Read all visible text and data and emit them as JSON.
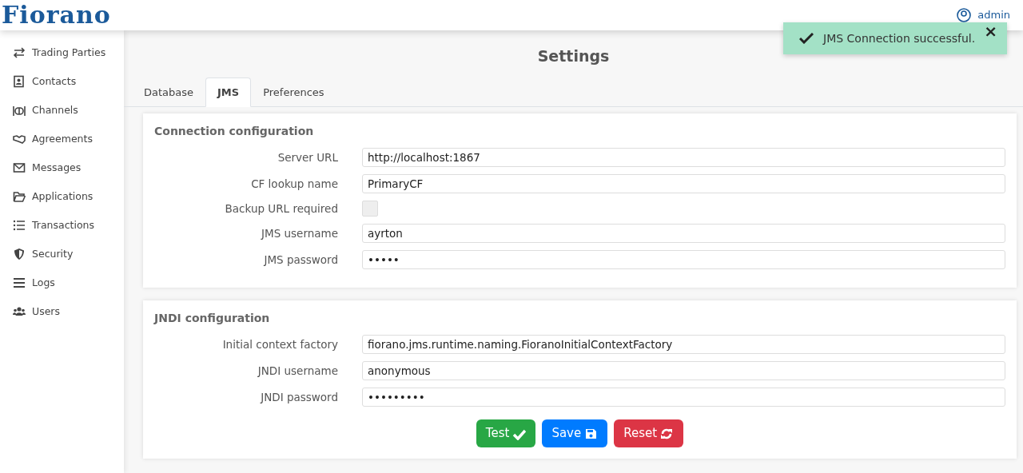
{
  "header": {
    "logo": "Fiorano",
    "user": "admin"
  },
  "sidebar": {
    "items": [
      {
        "label": "Trading Parties"
      },
      {
        "label": "Contacts"
      },
      {
        "label": "Channels"
      },
      {
        "label": "Agreements"
      },
      {
        "label": "Messages"
      },
      {
        "label": "Applications"
      },
      {
        "label": "Transactions"
      },
      {
        "label": "Security"
      },
      {
        "label": "Logs"
      },
      {
        "label": "Users"
      }
    ]
  },
  "page_title": "Settings",
  "tabs": [
    {
      "label": "Database",
      "selected": false
    },
    {
      "label": "JMS",
      "selected": true
    },
    {
      "label": "Preferences",
      "selected": false
    }
  ],
  "sections": [
    {
      "title": "Connection configuration",
      "fields": [
        {
          "kind": "text",
          "label": "Server URL",
          "value": "http://localhost:1867"
        },
        {
          "kind": "text",
          "label": "CF lookup name",
          "value": "PrimaryCF"
        },
        {
          "kind": "checkbox",
          "label": "Backup URL required",
          "checked": false
        },
        {
          "kind": "text",
          "label": "JMS username",
          "value": "ayrton"
        },
        {
          "kind": "text",
          "label": "JMS password",
          "value": "•••••"
        }
      ]
    },
    {
      "title": "JNDI configuration",
      "fields": [
        {
          "kind": "text",
          "label": "Initial context factory",
          "value": "fiorano.jms.runtime.naming.FioranoInitialContextFactory"
        },
        {
          "kind": "text",
          "label": "JNDI username",
          "value": "anonymous"
        },
        {
          "kind": "text",
          "label": "JNDI password",
          "value": "•••••••••"
        }
      ]
    }
  ],
  "buttons": [
    {
      "label": "Test",
      "kind": "test"
    },
    {
      "label": "Save",
      "kind": "save"
    },
    {
      "label": "Reset",
      "kind": "reset"
    }
  ],
  "toast": {
    "message": "JMS Connection successful.",
    "close": "×"
  }
}
